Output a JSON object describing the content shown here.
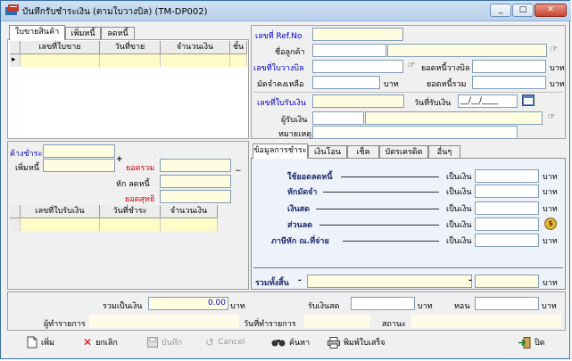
{
  "window": {
    "title": "บันทึกรับชำระเงิน (ตามใบวางบิล) (TM-DP002)",
    "min_label": "_",
    "max_label": "□",
    "close_label": "✕"
  },
  "left_tabs": [
    "ใบขายสินค้า",
    "เพิ่มหนี้",
    "ลดหนี้"
  ],
  "invoice_grid": {
    "columns": [
      "เลขที่ใบขาย",
      "วันที่ขาย",
      "จำนวนเงิน",
      "ชั้นท"
    ]
  },
  "header_form": {
    "ref_label": "เลขที่ Ref.No",
    "customer_label": "ชื่อลูกค้า",
    "bill_label": "เลขที่ใบวางบิล",
    "bill_amount_label": "ยอดหนี้วางบิล",
    "deposit_label": "มัดจำคงเหลือ",
    "baht1": "บาท",
    "total_debt_label": "ยอดหนี้รวม",
    "baht2": "บาท",
    "baht3": "บาท"
  },
  "receipt_form": {
    "receipt_no_label": "เลขที่ใบรับเงิน",
    "receipt_date_label": "วันที่รับเงิน",
    "receipt_date_value": "__/__/____",
    "receiver_label": "ผู้รับเงิน",
    "note_label": "หมายเหตุ"
  },
  "summary_left": {
    "outstanding_label": "ค้างชำระ",
    "add_debt_label": "เพิ่มหนี้",
    "plus": "+",
    "total_label": "ยอดรวม",
    "minus": "−",
    "deduct_label": "หัก ลดหนี้",
    "net_label": "ยอดสุทธิ"
  },
  "payment_grid": {
    "columns": [
      "เลขที่ใบรับเงิน",
      "วันที่ชำระ",
      "จำนวนเงิน"
    ]
  },
  "payment_tabs": [
    "ข้อมูลการชำระ",
    "เงินโอน",
    "เช็ค",
    "บัตรเครดิต",
    "อื่นๆ"
  ],
  "payment_rows": [
    {
      "label": "ใช้ยอดลดหนี้",
      "unit_label": "เป็นเงิน",
      "baht": "บาท"
    },
    {
      "label": "หักมัดจำ",
      "unit_label": "เป็นเงิน",
      "baht": "บาท"
    },
    {
      "label": "เงินสด",
      "unit_label": "เป็นเงิน",
      "baht": "บาท"
    },
    {
      "label": "ส่วนลด",
      "unit_label": "เป็นเงิน",
      "baht": "บาท"
    },
    {
      "label": "ภาษีหัก ณ.ที่จ่าย",
      "unit_label": "เป็นเงิน",
      "baht": "บาท"
    }
  ],
  "payment_total": {
    "label": "รวมทั้งสิ้น",
    "dash": "-",
    "baht": "บาท"
  },
  "bottom": {
    "sum_label": "รวมเป็นเงิน",
    "sum_value": "0.00",
    "sum_baht": "บาท",
    "cash_label": "รับเงินสด",
    "cash_baht": "บาท",
    "change_label": "ทอน",
    "change_baht": "บาท",
    "operator_label": "ผู้ทำรายการ",
    "txdate_label": "วันที่ทำรายการ",
    "status_label": "สถานะ"
  },
  "toolbar": {
    "add": "เพิ่ม",
    "cancel_doc": "ยกเลิก",
    "save": "บันทึก",
    "cancel": "Cancel",
    "search": "ค้นหา",
    "print": "พิมพ์ใบเสร็จ",
    "close": "ปิด"
  },
  "colors": {
    "accent": "#0000cc",
    "required": "#cc0000",
    "field": "#fffde0"
  }
}
